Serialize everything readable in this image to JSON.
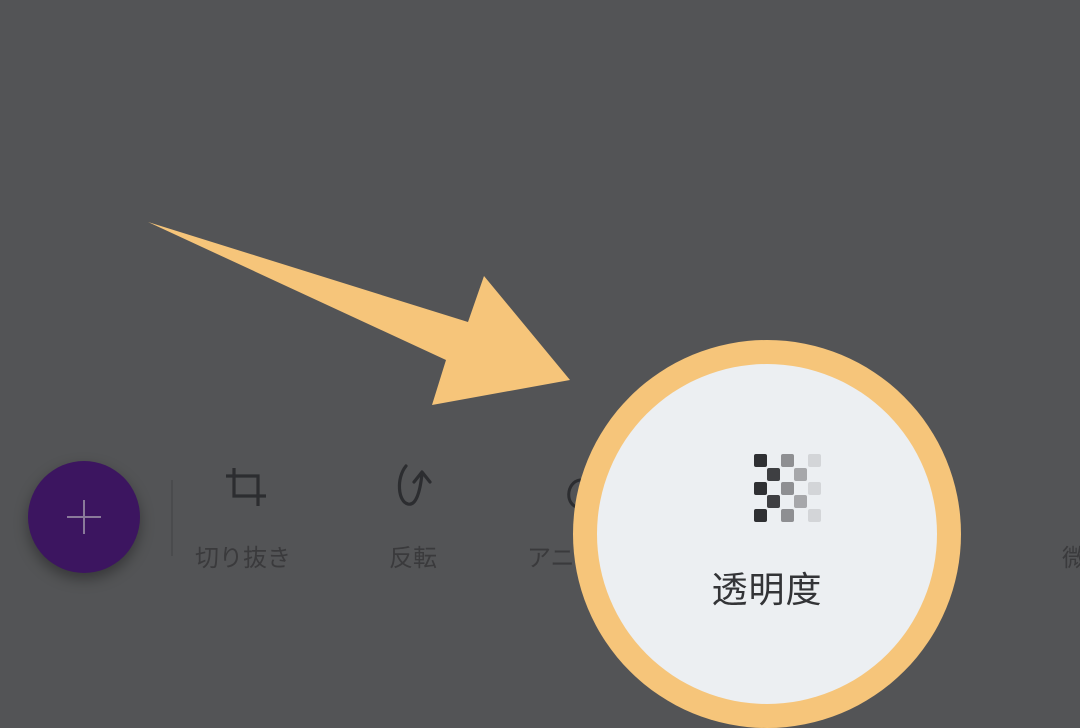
{
  "fab": {
    "icon": "plus-icon"
  },
  "toolbar": {
    "items": [
      {
        "label": "切り抜き",
        "icon": "crop-icon"
      },
      {
        "label": "反転",
        "icon": "flip-icon"
      },
      {
        "label": "アニ",
        "icon": "animation-icon"
      },
      {
        "label": "微",
        "icon": "adjust-icon"
      }
    ]
  },
  "highlight": {
    "label": "透明度",
    "icon": "transparency-icon",
    "ring_color": "#f6c57a",
    "arrow_color": "#f6c57a"
  }
}
